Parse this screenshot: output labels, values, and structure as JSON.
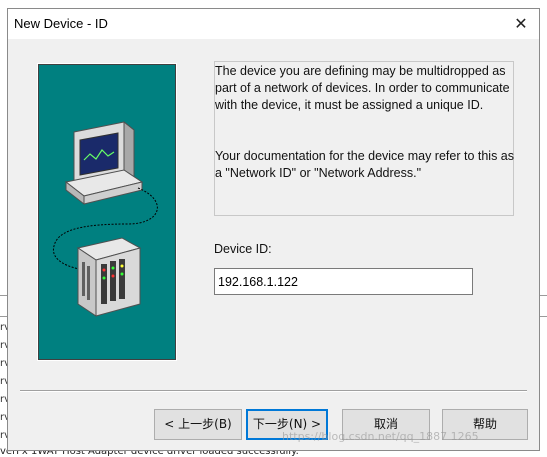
{
  "dialog": {
    "title": "New Device - ID",
    "close_glyph": "✕",
    "info_paragraph_1": "The device you are defining may be multidropped as part of a network of devices.  In order to communicate with the device, it must be assigned a unique ID.",
    "info_paragraph_2": "Your documentation for the device may refer to this as a \"Network ID\" or \"Network Address.\"",
    "device_id_label": "Device ID:",
    "device_id_value": "192.168.1.122",
    "illustration_icons": [
      "computer-icon",
      "network-cable-icon",
      "rack-device-icon"
    ],
    "illustration_bg": "#008080"
  },
  "buttons": {
    "back": "< 上一步(B)",
    "next": "下一步(N) >",
    "cancel": "取消",
    "help": "帮助"
  },
  "background": {
    "fragments": [
      "rv",
      "rv",
      "rv",
      "rv",
      "rv",
      "rv",
      "rv"
    ],
    "status_line": "verFx      1WAY Host Adapter device driver loaded successfully."
  },
  "watermark": "https://blog.csdn.net/qq_1887 1265"
}
